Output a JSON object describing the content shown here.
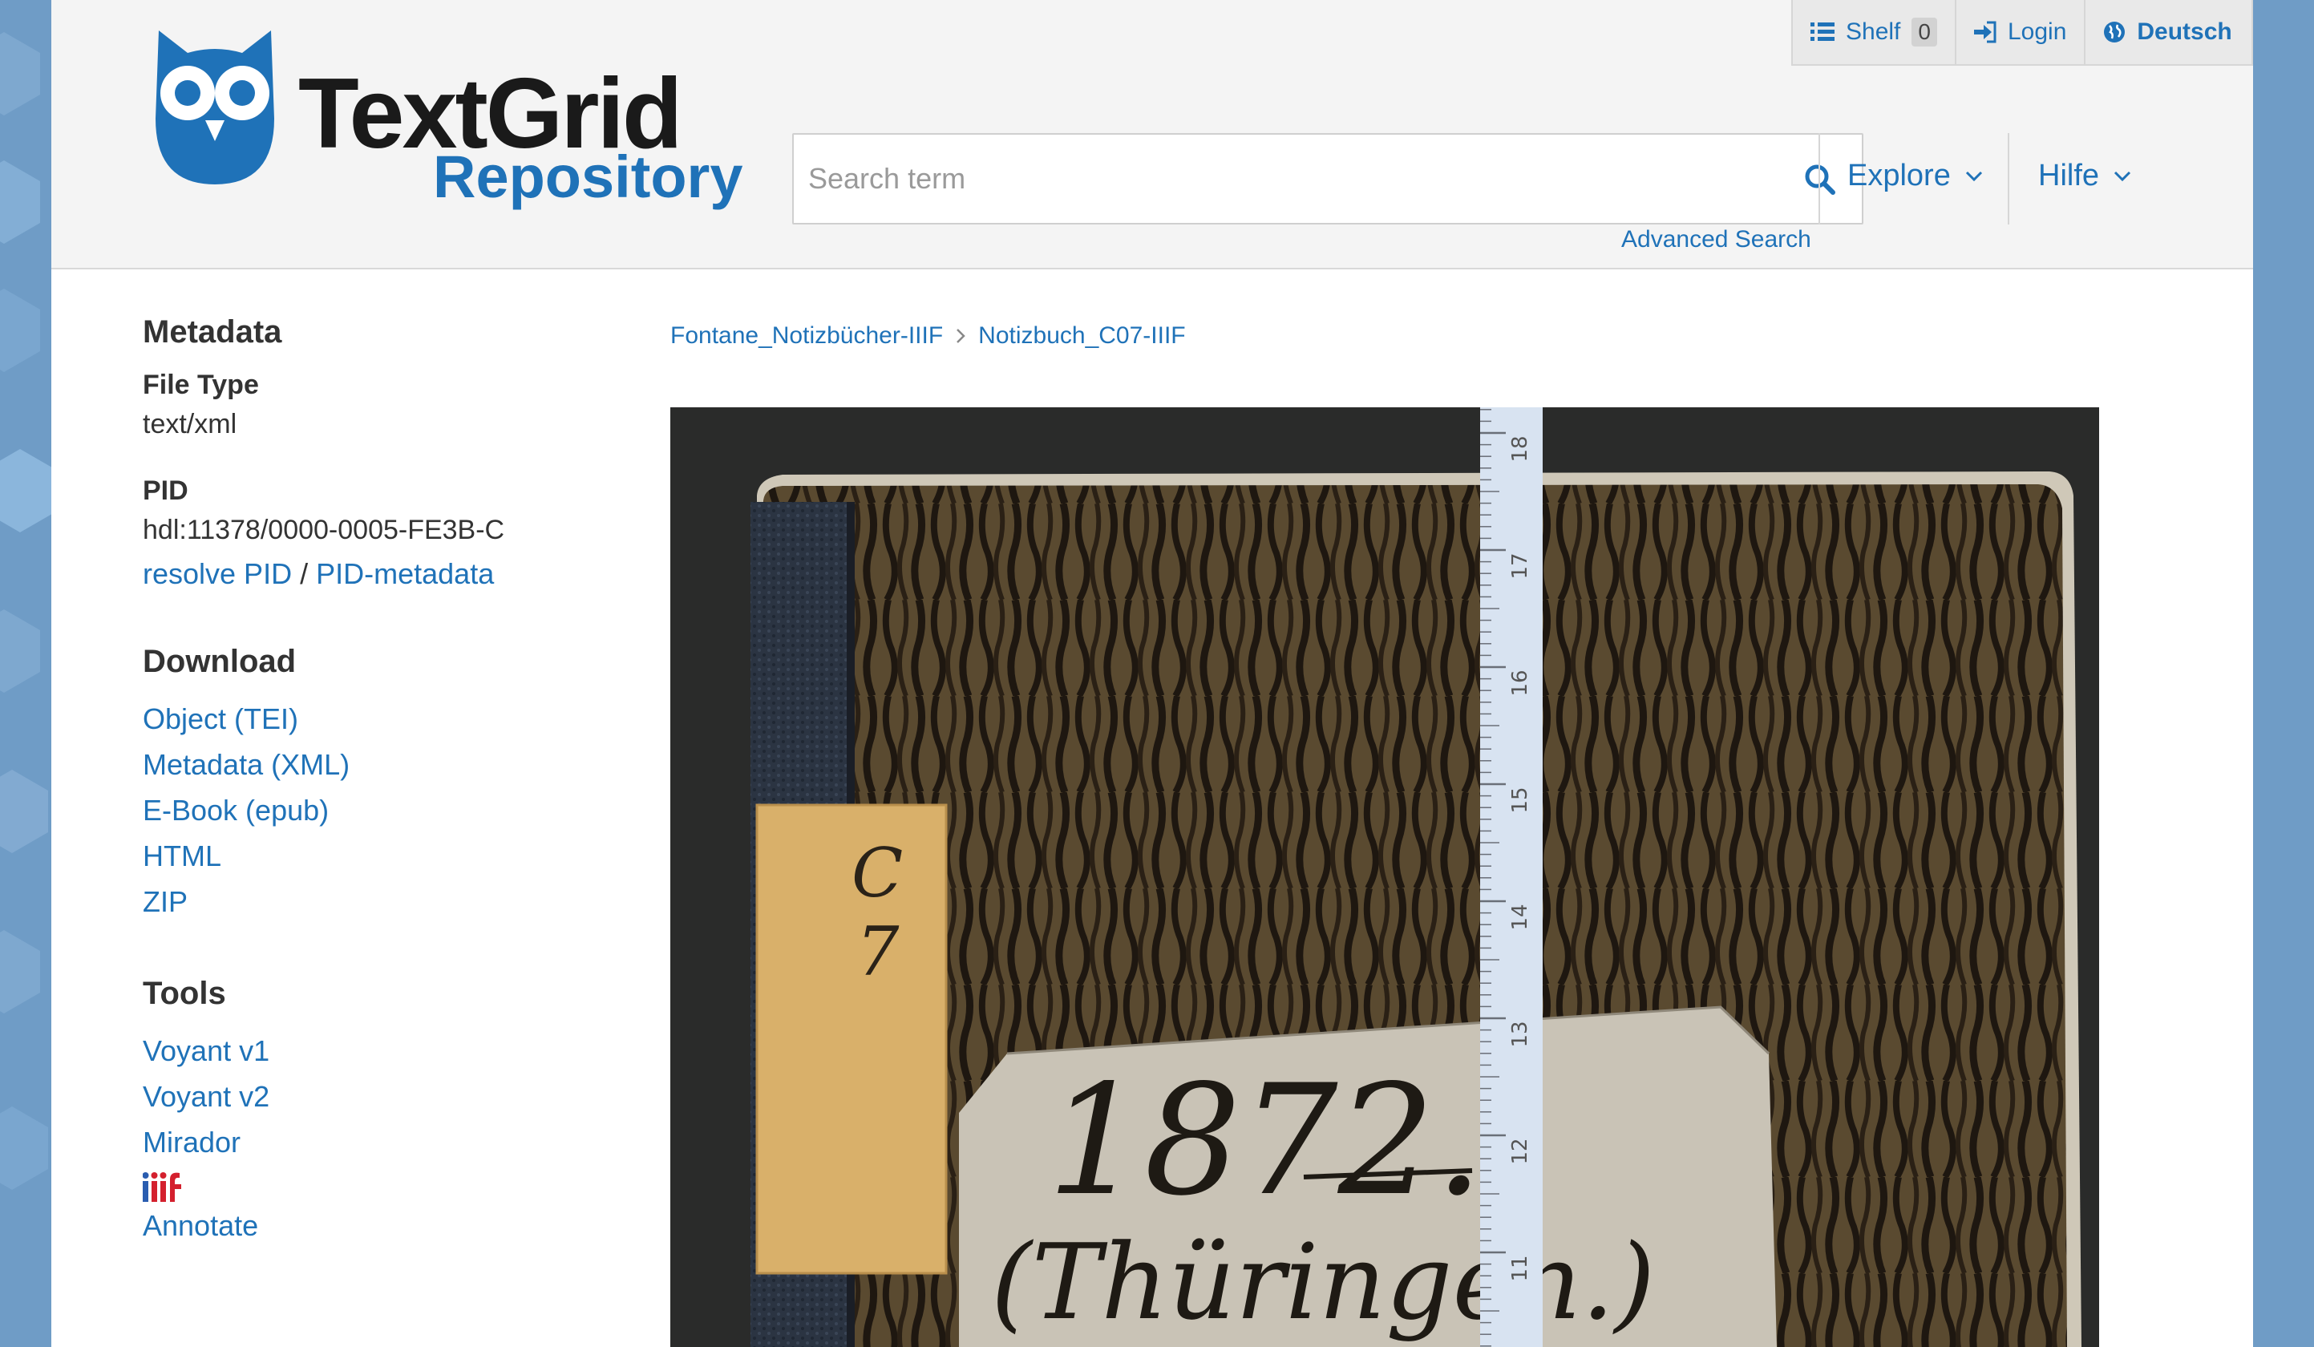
{
  "header": {
    "logo_title": "TextGrid",
    "logo_sub": "Repository",
    "topbar": {
      "shelf_label": "Shelf",
      "shelf_count": "0",
      "login_label": "Login",
      "language_label": "Deutsch"
    },
    "search": {
      "placeholder": "Search term",
      "advanced_label": "Advanced Search"
    },
    "nav": {
      "explore_label": "Explore",
      "help_label": "Hilfe"
    }
  },
  "sidebar": {
    "metadata_heading": "Metadata",
    "file_type_label": "File Type",
    "file_type_value": "text/xml",
    "pid_label": "PID",
    "pid_value": "hdl:11378/0000-0005-FE3B-C",
    "resolve_pid": "resolve PID",
    "pid_separator": "/",
    "pid_metadata": "PID-metadata",
    "download_heading": "Download",
    "download_links": [
      "Object (TEI)",
      "Metadata (XML)",
      "E-Book (epub)",
      "HTML",
      "ZIP"
    ],
    "tools_heading": "Tools",
    "tool_links": [
      "Voyant v1",
      "Voyant v2",
      "Mirador"
    ],
    "annotate_label": "Annotate"
  },
  "breadcrumb": {
    "items": [
      "Fontane_Notizbücher-IIIF",
      "Notizbuch_C07-IIIF"
    ]
  },
  "viewer": {
    "spine_label_line1": "C",
    "spine_label_line2": "7",
    "cover_year": "1872..",
    "cover_place": "(Thüringen.)",
    "ruler_labels": [
      "18",
      "17",
      "16",
      "15",
      "14",
      "13",
      "12",
      "11"
    ]
  },
  "colors": {
    "link": "#1f72b8",
    "header_bg": "#f4f4f4",
    "iiif_red": "#d4202e",
    "iiif_blue": "#2a5db0"
  }
}
